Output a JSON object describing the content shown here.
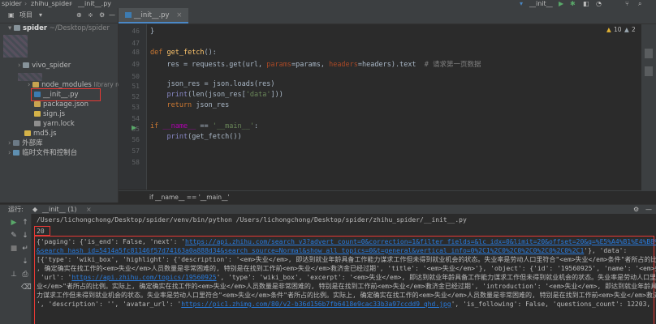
{
  "nav": {
    "project_name": "spider",
    "module_name": "zhihu_spider",
    "file_name": "__init__.py",
    "run_config": "__init__",
    "branch_icon": "branch-icon"
  },
  "project": {
    "title": "项目",
    "root_label": "spider",
    "root_path": "~/Desktop/spider",
    "items": [
      {
        "label": "vivo_spider",
        "icon": "folder-icon"
      },
      {
        "label": "node_modules",
        "extra": "library ro",
        "icon": "folder-icon"
      },
      {
        "label": "__init__.py",
        "icon": "python-file-icon"
      },
      {
        "label": "package.json",
        "icon": "json-file-icon"
      },
      {
        "label": "sign.js",
        "icon": "js-file-icon"
      },
      {
        "label": "yarn.lock",
        "icon": "lock-file-icon"
      },
      {
        "label": "md5.js",
        "icon": "js-file-icon"
      },
      {
        "label": "外部库",
        "icon": "library-icon"
      },
      {
        "label": "临时文件和控制台",
        "icon": "scratch-icon"
      }
    ]
  },
  "editor": {
    "tab_label": "__init__.py",
    "warnings": "10",
    "weak_warnings": "2",
    "breadcrumb": "if __name__ == '__main__'",
    "line_numbers": [
      "46",
      "47",
      "48",
      "49",
      "50",
      "51",
      "52",
      "53",
      "54",
      "55",
      "56",
      "57",
      "58"
    ],
    "code": {
      "l46": "}",
      "l48_kw": "def ",
      "l48_fn": "get_fetch",
      "l48_rest": "():",
      "l49_a": "    res = requests.get(url, ",
      "l49_p1": "params",
      "l49_b": "=params, ",
      "l49_p2": "headers",
      "l49_c": "=headers).text  ",
      "l49_cmt": "# 请求第一页数据",
      "l51": "    json_res = json.loads(res)",
      "l52_a": "    ",
      "l52_bi": "print",
      "l52_b": "(len(json_res[",
      "l52_str": "'data'",
      "l52_c": "]))",
      "l53_kw": "    return ",
      "l53_rest": "json_res",
      "l55_kw": "if ",
      "l55_mag": "__name__",
      "l55_b": " == ",
      "l55_str": "'__main__'",
      "l55_c": ":",
      "l56_a": "    ",
      "l56_bi": "print",
      "l56_b": "(get_fetch())"
    }
  },
  "run": {
    "label": "运行:",
    "config_tab": "__init__ (1)",
    "command": "/Users/lichongchong/Desktop/spider/venv/bin/python /Users/lichongchong/Desktop/spider/zhihu_spider/__init__.py",
    "count": "20",
    "lines": {
      "l1_a": "{'paging': {'is_end': False, 'next': '",
      "l1_link": "https://api.zhihu.com/search_v3?advert_count=0&correction=1&filter_fields=&lc_idx=0&limit=20&offset=20&q=%E5%A4%B1%E4%B8%9A",
      "l2_link": "&search_hash_id=5414a5fc81146f57d74163a0a888d34&search_source=Normal&show_all_topics=0&t=general&vertical_info=0%2C1%2C0%2C0%2C0%2C0%2C0%2C1",
      "l2_b": "'}, 'data':",
      "l3": "[{'type': 'wiki_box', 'highlight': {'description': '<em>失业</em>, 即达到就业年龄具备工作能力谋求工作但未得到就业机会的状态。失业率是劳动人口里符合\"<em>失业</em>条件\"者所占的比例。实际",
      "l4": ", 确定确实在找工作的<em>失业</em>人员数量是非常困难的, 特别是在找到工作前<em>失业</em>救济金已经过期', 'title': '<em>失业</em>'}, 'object': {'id': '19560925', 'name': '<em>失业</em>',",
      "l5_a": " 'url': '",
      "l5_link": "https://api.zhihu.com/topics/19560925",
      "l5_b": "', 'type': 'wiki_box', 'excerpt': '<em>失业</em>, 即达到就业年龄具备工作能力谋求工作但未得到就业机会的状态。失业率是劳动人口里符合\"<em>失",
      "l6": "业</em>\"者所占的比例。实际上, 确定确实在找工作的<em>失业</em>人员数量是非常困难的, 特别是在找到工作前<em>失业</em>救济金已经过期', 'introduction': '<em>失业</em>, 即达到就业年龄具备工",
      "l7": "力谋求工作但未得到就业机会的状态。失业率是劳动人口里符合\"<em>失业</em>条件\"者所占的比例。实际上, 确定确实在找工作的<em>失业</em>人员数量是非常困难的, 特别是在找到工作前<em>失业</em>救济金已经",
      "l8_a": "', 'description': '', 'avatar_url': '",
      "l8_link": "https://pic1.zhimg.com/80/v2-b36d156b7fb6418e9cac33b3a97ccdd9_qhd.jpg",
      "l8_b": "', 'is_following': False, 'questions_count': 12203,"
    }
  },
  "colors": {
    "highlight_box": "#e53935",
    "link": "#287bde",
    "keyword": "#cc7832"
  }
}
